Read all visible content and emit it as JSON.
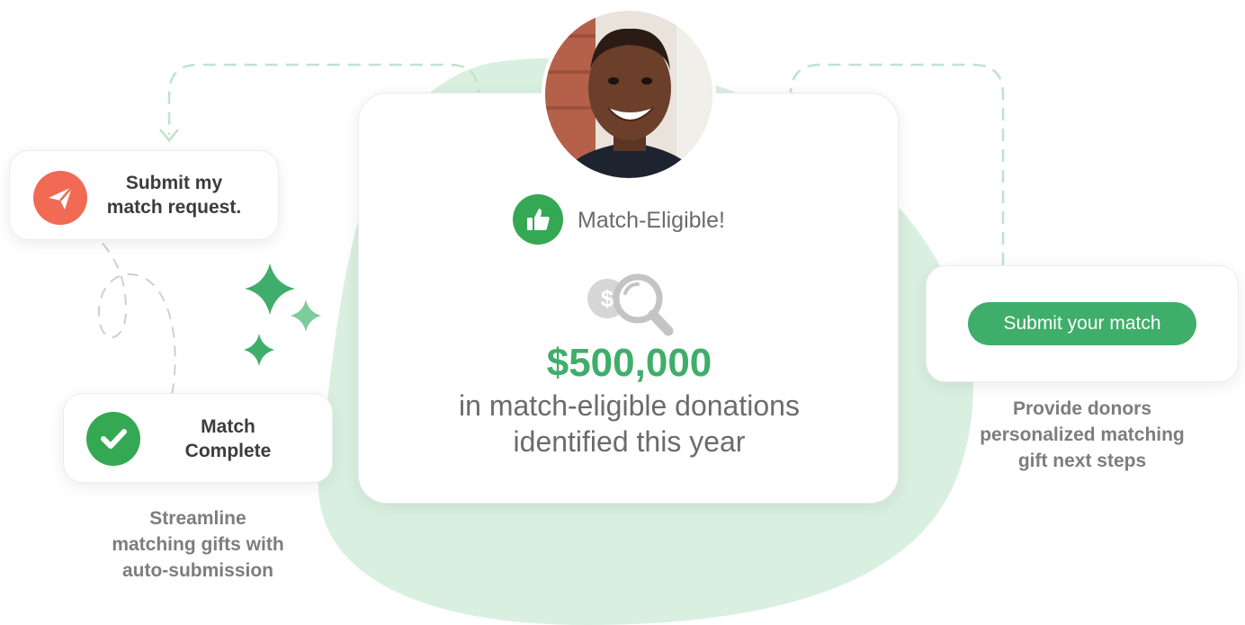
{
  "submit_request_card": {
    "label_line1": "Submit my",
    "label_line2": "match request.",
    "icon": "paper-plane-icon"
  },
  "match_complete_card": {
    "label_line1": "Match",
    "label_line2": "Complete",
    "icon": "checkmark-icon"
  },
  "caption_left": {
    "line1": "Streamline",
    "line2": "matching gifts with",
    "line3": "auto-submission"
  },
  "center_card": {
    "status_label": "Match-Eligible!",
    "status_icon": "thumbs-up-icon",
    "amount": "$500,000",
    "description_line1": "in match-eligible donations",
    "description_line2": "identified this year",
    "avatar": "donor-photo"
  },
  "submit_match_card": {
    "button_label": "Submit your match"
  },
  "caption_right": {
    "line1": "Provide donors",
    "line2": "personalized matching",
    "line3": "gift next steps"
  },
  "colors": {
    "brand_green": "#3fae6a",
    "check_green": "#34a853",
    "send_red": "#f26a54",
    "blob_green": "#d9f0e1",
    "dash_green": "#bfe3cc"
  }
}
